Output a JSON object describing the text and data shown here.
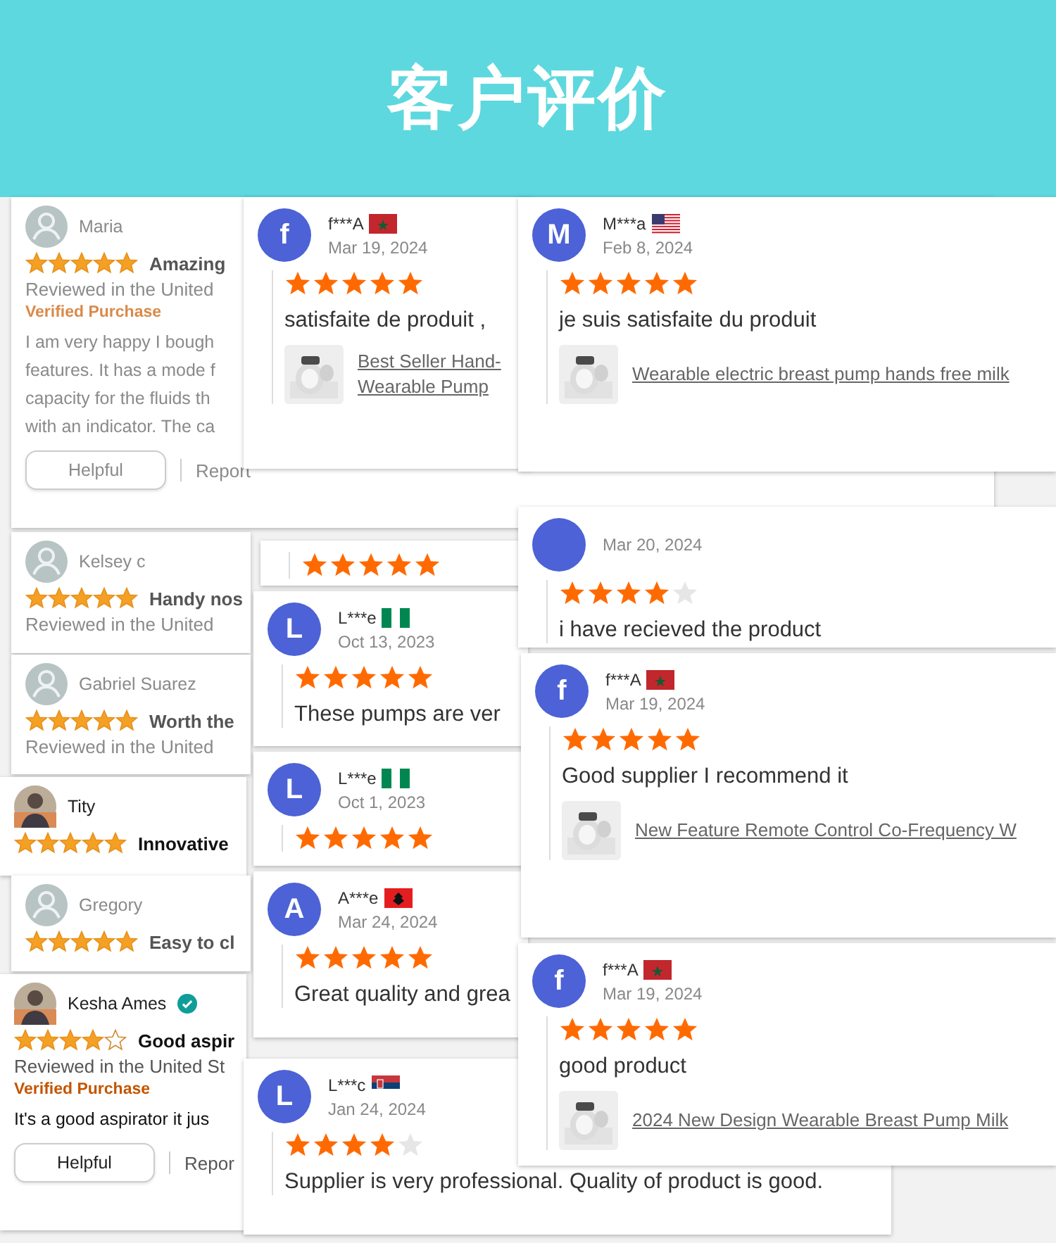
{
  "header": {
    "title": "客户评价"
  },
  "amazon_reviews": [
    {
      "name": "Maria",
      "avatar": {
        "kind": "generic"
      },
      "verified": false,
      "faded": true,
      "stars": 5,
      "title": "Amazing",
      "reviewed": "Reviewed in the United",
      "verified_purchase": "Verified Purchase",
      "body": [
        "I am very happy I bough",
        "features. It has a mode f",
        "capacity for the fluids th",
        "with an indicator. The ca"
      ],
      "helpful": "Helpful",
      "report": "Report"
    },
    {
      "name": "Kelsey c",
      "avatar": {
        "kind": "generic"
      },
      "verified": false,
      "faded": true,
      "stars": 5,
      "title": "Handy nos",
      "reviewed": "Reviewed in the United"
    },
    {
      "name": "Gabriel Suarez",
      "avatar": {
        "kind": "generic"
      },
      "verified": false,
      "faded": true,
      "stars": 5,
      "title": "Worth the",
      "reviewed": "Reviewed in the United"
    },
    {
      "name": "Tity",
      "avatar": {
        "kind": "picture"
      },
      "verified": false,
      "faded": false,
      "stars": 5,
      "title": "Innovative"
    },
    {
      "name": "Gregory",
      "avatar": {
        "kind": "generic"
      },
      "verified": false,
      "faded": true,
      "stars": 5,
      "title": "Easy to cl"
    },
    {
      "name": "Kesha Ames",
      "avatar": {
        "kind": "picture"
      },
      "verified": true,
      "faded": false,
      "stars": 4,
      "title": "Good aspir",
      "reviewed": "Reviewed in the United St",
      "verified_purchase": "Verified Purchase",
      "body": [
        "It's a good aspirator it jus"
      ],
      "helpful": "Helpful",
      "report": "Repor"
    }
  ],
  "buyer_reviews_left": [
    {
      "initial": "f",
      "name": "f***A",
      "flag": {
        "kind": "ma"
      },
      "date": "Mar 19, 2024",
      "stars": 5,
      "text": "satisfaite de produit ,",
      "product": [
        "Best Seller Hand-",
        "Wearable Pump"
      ]
    },
    {
      "stars": 5
    },
    {
      "initial": "L",
      "name": "L***e",
      "flag": {
        "kind": "ng"
      },
      "date": "Oct 13, 2023",
      "stars": 5,
      "text": "These pumps are ver"
    },
    {
      "initial": "L",
      "name": "L***e",
      "flag": {
        "kind": "ng"
      },
      "date": "Oct 1, 2023",
      "stars": 5
    },
    {
      "initial": "A",
      "name": "A***e",
      "flag": {
        "kind": "al"
      },
      "date": "Mar 24, 2024",
      "stars": 5,
      "text": "Great quality and grea"
    },
    {
      "initial": "L",
      "name": "L***c",
      "flag": {
        "kind": "rs"
      },
      "date": "Jan 24, 2024",
      "stars": 4,
      "text": "Supplier is very professional. Quality of product is good."
    }
  ],
  "buyer_reviews_right": [
    {
      "initial": "M",
      "name": "M***a",
      "flag": {
        "kind": "us"
      },
      "date": "Feb 8, 2024",
      "stars": 5,
      "text": "je suis satisfaite du produit",
      "product": [
        "Wearable electric breast pump hands free milk"
      ]
    },
    {
      "date": "Mar 20, 2024",
      "stars": 4,
      "text": "i have recieved the product"
    },
    {
      "initial": "f",
      "name": "f***A",
      "flag": {
        "kind": "ma"
      },
      "date": "Mar 19, 2024",
      "stars": 5,
      "text": "Good supplier I recommend it",
      "product": [
        "New Feature Remote Control Co-Frequency W"
      ]
    },
    {
      "initial": "f",
      "name": "f***A",
      "flag": {
        "kind": "ma"
      },
      "date": "Mar 19, 2024",
      "stars": 5,
      "text": "good product",
      "product": [
        "2024 New Design Wearable Breast Pump Milk"
      ]
    }
  ]
}
